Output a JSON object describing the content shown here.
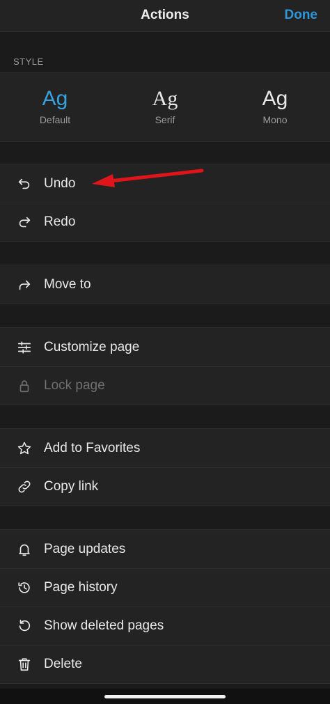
{
  "header": {
    "title": "Actions",
    "done_label": "Done"
  },
  "style": {
    "section_label": "STYLE",
    "options": [
      {
        "glyph": "Ag",
        "name": "Default",
        "selected": true
      },
      {
        "glyph": "Ag",
        "name": "Serif",
        "selected": false
      },
      {
        "glyph": "Ag",
        "name": "Mono",
        "selected": false
      }
    ]
  },
  "groups": [
    {
      "items": [
        {
          "label": "Undo",
          "icon": "undo-icon",
          "disabled": false
        },
        {
          "label": "Redo",
          "icon": "redo-icon",
          "disabled": false
        }
      ]
    },
    {
      "items": [
        {
          "label": "Move to",
          "icon": "move-arrow-icon",
          "disabled": false
        }
      ]
    },
    {
      "items": [
        {
          "label": "Customize page",
          "icon": "sliders-icon",
          "disabled": false
        },
        {
          "label": "Lock page",
          "icon": "lock-icon",
          "disabled": true
        }
      ]
    },
    {
      "items": [
        {
          "label": "Add to Favorites",
          "icon": "star-icon",
          "disabled": false
        },
        {
          "label": "Copy link",
          "icon": "link-icon",
          "disabled": false
        }
      ]
    },
    {
      "items": [
        {
          "label": "Page updates",
          "icon": "bell-icon",
          "disabled": false
        },
        {
          "label": "Page history",
          "icon": "history-icon",
          "disabled": false
        },
        {
          "label": "Show deleted pages",
          "icon": "restore-icon",
          "disabled": false
        },
        {
          "label": "Delete",
          "icon": "trash-icon",
          "disabled": false
        }
      ]
    }
  ],
  "colors": {
    "accent": "#2f97d8",
    "background": "#1b1b1b",
    "surface": "#232323",
    "annotation": "#e0141b"
  }
}
